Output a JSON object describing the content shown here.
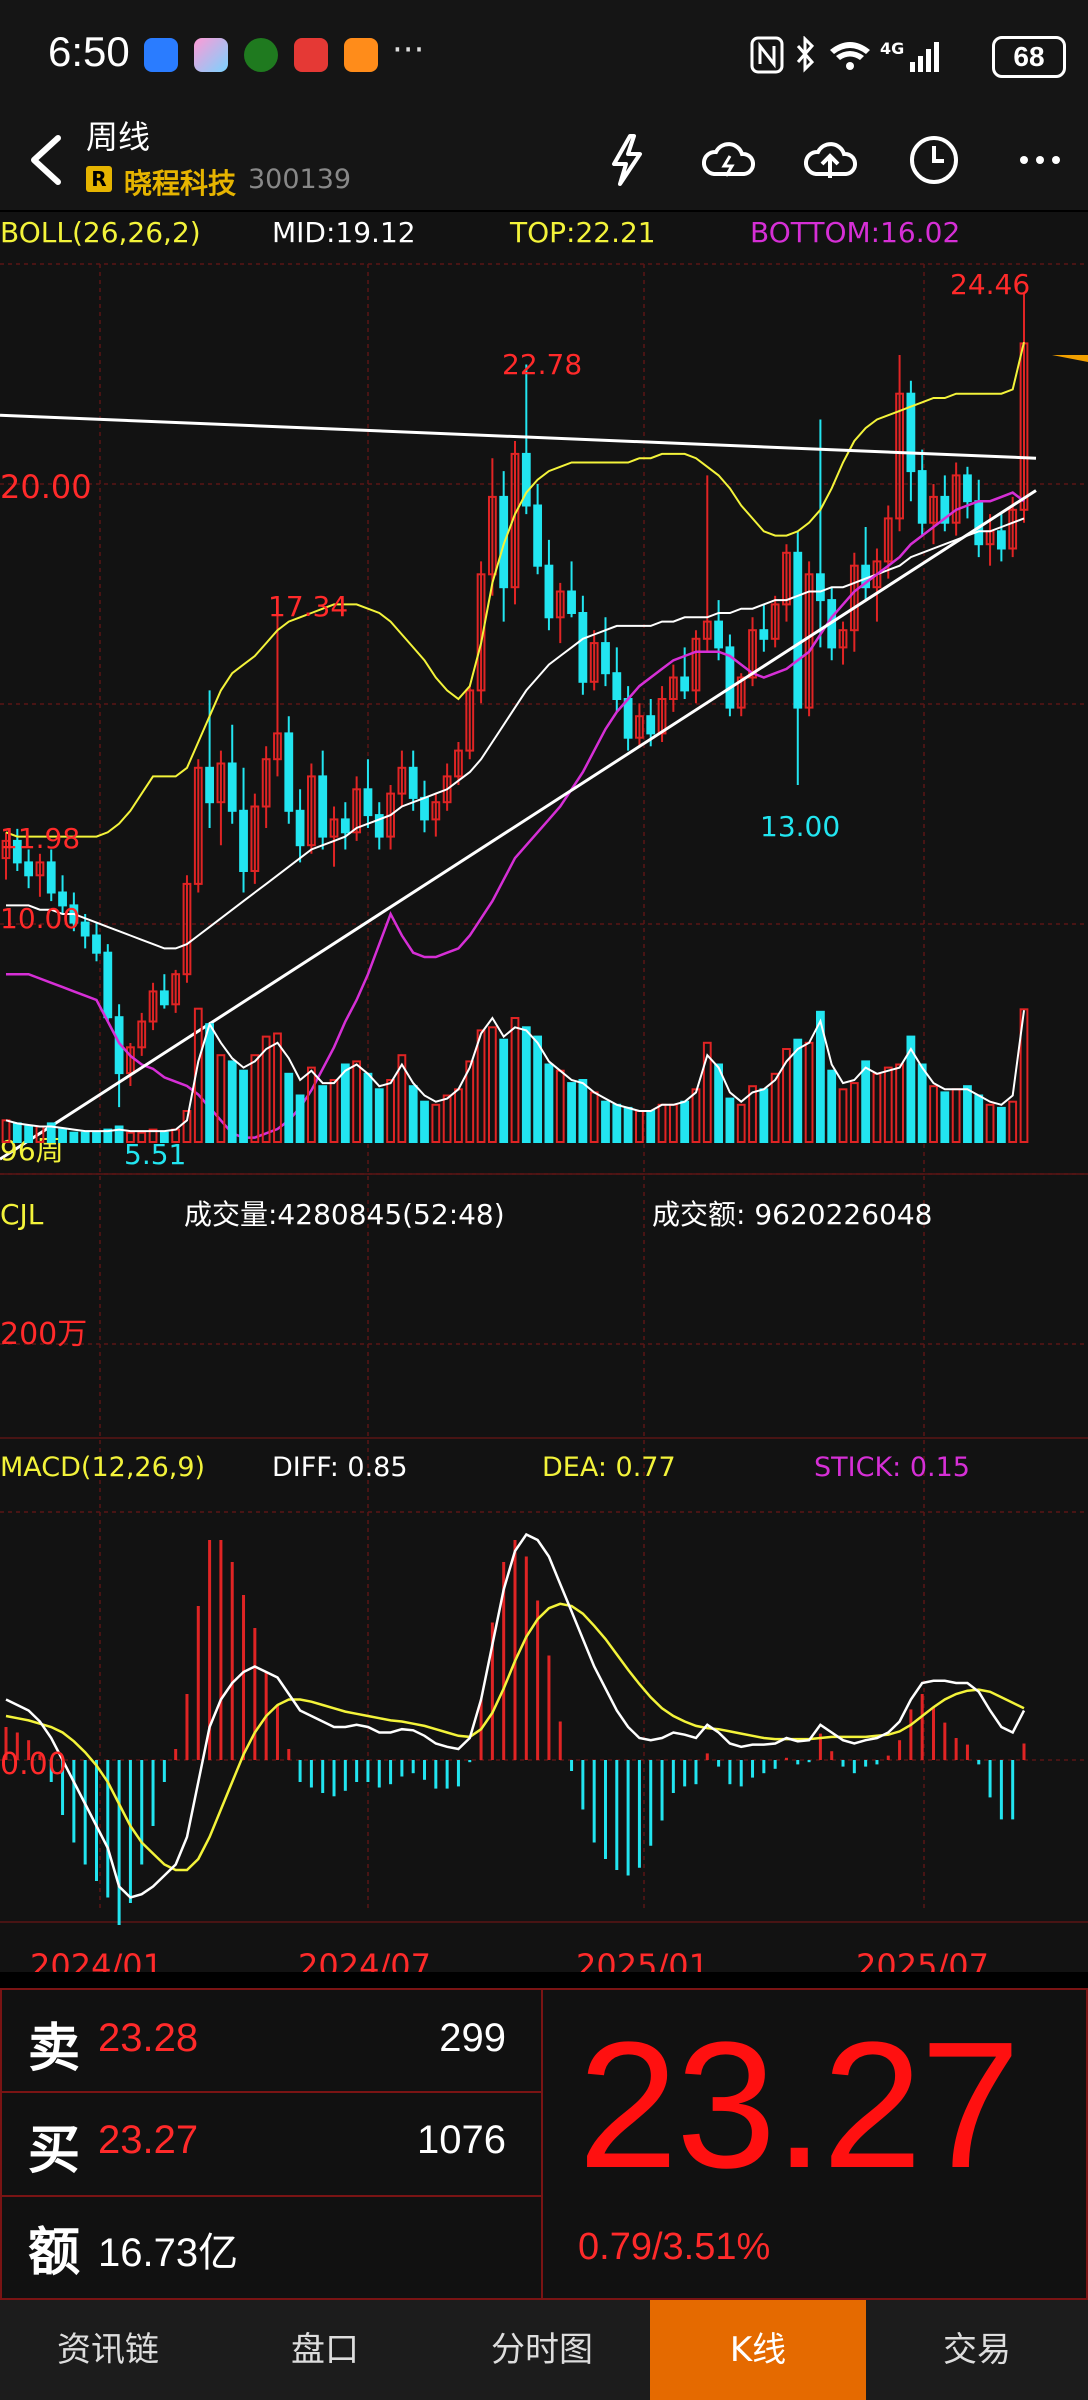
{
  "status_bar": {
    "time": "6:50",
    "more": "···",
    "network": "4G",
    "battery": "68",
    "icons": [
      "weather-icon",
      "gallery-icon",
      "game-icon",
      "huawei-icon",
      "video-icon",
      "nfc-icon",
      "bluetooth-icon",
      "wifi-icon",
      "signal-icon"
    ]
  },
  "header": {
    "title": "周线",
    "badge": "R",
    "stock_name": "晓程科技",
    "stock_code": "300139",
    "icons": [
      "back-icon",
      "flash-icon",
      "cloud-refresh-icon",
      "cloud-upload-icon",
      "clock-icon",
      "more-icon"
    ]
  },
  "boll": {
    "label": "BOLL(26,26,2)",
    "mid": "MID:19.12",
    "top": "TOP:22.21",
    "bottom": "BOTTOM:16.02"
  },
  "price_chart": {
    "y_label_20": "20.00",
    "y_label_10": "10.00",
    "y_label_1198": "11.98",
    "period_label": "96周",
    "annotations": {
      "high_2446": "24.46",
      "high_2278": "22.78",
      "high_1734": "17.34",
      "low_1300": "13.00",
      "low_551": "5.51"
    }
  },
  "volume": {
    "label": "CJL",
    "volume_text": "成交量:4280845(52:48)",
    "amount_text": "成交额: 9620226048",
    "y_label": "200万"
  },
  "macd": {
    "label": "MACD(12,26,9)",
    "diff": "DIFF: 0.85",
    "dea": "DEA: 0.77",
    "stick": "STICK: 0.15",
    "zero_label": "0.00"
  },
  "x_axis": [
    "2024/01",
    "2024/07",
    "2025/01",
    "2025/07"
  ],
  "quote": {
    "sell_label": "卖",
    "sell_price": "23.28",
    "sell_volume": "299",
    "buy_label": "买",
    "buy_price": "23.27",
    "buy_volume": "1076",
    "amount_label": "额",
    "amount_value": "16.73亿",
    "last_price": "23.27",
    "change": "0.79/3.51%"
  },
  "tabs": [
    {
      "label": "资讯链",
      "active": false
    },
    {
      "label": "盘口",
      "active": false
    },
    {
      "label": "分时图",
      "active": false
    },
    {
      "label": "K线",
      "active": true
    },
    {
      "label": "交易",
      "active": false
    }
  ],
  "colors": {
    "up": "#e02424",
    "down": "#22e5f0",
    "boll_top_bottom_upper": "#f3f33a",
    "boll_mid": "#ffffff",
    "boll_lower": "#d62fd6",
    "accent": "#e56a00",
    "grid": "#5a1010"
  },
  "chart_data": {
    "type": "candlestick",
    "candles": [
      [
        11.3,
        11.9,
        10.8,
        11.7
      ],
      [
        11.7,
        11.98,
        11.0,
        11.2
      ],
      [
        11.2,
        11.5,
        10.6,
        10.9
      ],
      [
        10.9,
        11.4,
        10.4,
        11.2
      ],
      [
        11.2,
        11.5,
        10.3,
        10.5
      ],
      [
        10.5,
        10.9,
        10.0,
        10.2
      ],
      [
        10.2,
        10.5,
        9.6,
        9.8
      ],
      [
        9.8,
        10.0,
        9.2,
        9.5
      ],
      [
        9.5,
        9.8,
        8.9,
        9.1
      ],
      [
        9.1,
        9.3,
        7.5,
        7.6
      ],
      [
        7.6,
        7.9,
        5.51,
        6.3
      ],
      [
        6.3,
        7.0,
        6.0,
        6.9
      ],
      [
        6.9,
        7.7,
        6.7,
        7.5
      ],
      [
        7.5,
        8.4,
        7.3,
        8.2
      ],
      [
        8.2,
        8.6,
        7.8,
        7.9
      ],
      [
        7.9,
        8.7,
        7.7,
        8.6
      ],
      [
        8.6,
        10.9,
        8.4,
        10.7
      ],
      [
        10.7,
        13.6,
        10.5,
        13.4
      ],
      [
        13.4,
        15.2,
        12.0,
        12.6
      ],
      [
        12.6,
        13.8,
        11.6,
        13.5
      ],
      [
        13.5,
        14.4,
        12.1,
        12.4
      ],
      [
        12.4,
        13.4,
        10.5,
        11.0
      ],
      [
        11.0,
        12.8,
        10.7,
        12.5
      ],
      [
        12.5,
        13.9,
        12.0,
        13.6
      ],
      [
        13.6,
        17.34,
        13.2,
        14.2
      ],
      [
        14.2,
        14.6,
        12.1,
        12.4
      ],
      [
        12.4,
        12.9,
        11.2,
        11.6
      ],
      [
        11.6,
        13.5,
        11.4,
        13.2
      ],
      [
        13.2,
        13.8,
        11.5,
        11.8
      ],
      [
        11.8,
        12.5,
        11.1,
        12.2
      ],
      [
        12.2,
        12.6,
        11.5,
        11.9
      ],
      [
        11.9,
        13.2,
        11.7,
        12.9
      ],
      [
        12.9,
        13.6,
        12.0,
        12.3
      ],
      [
        12.3,
        12.6,
        11.5,
        11.8
      ],
      [
        11.8,
        13.0,
        11.5,
        12.8
      ],
      [
        12.8,
        13.8,
        12.5,
        13.4
      ],
      [
        13.4,
        13.8,
        12.4,
        12.7
      ],
      [
        12.7,
        13.1,
        11.9,
        12.2
      ],
      [
        12.2,
        12.8,
        11.8,
        12.6
      ],
      [
        12.6,
        13.5,
        12.4,
        13.2
      ],
      [
        13.2,
        14.0,
        13.0,
        13.8
      ],
      [
        13.8,
        15.3,
        13.6,
        15.2
      ],
      [
        15.2,
        18.2,
        14.9,
        17.9
      ],
      [
        17.9,
        20.6,
        17.4,
        19.7
      ],
      [
        19.7,
        20.3,
        16.8,
        17.6
      ],
      [
        17.6,
        21.0,
        17.2,
        20.7
      ],
      [
        20.7,
        22.78,
        19.3,
        19.5
      ],
      [
        19.5,
        20.0,
        17.9,
        18.1
      ],
      [
        18.1,
        18.7,
        16.6,
        16.9
      ],
      [
        16.9,
        17.7,
        16.3,
        17.5
      ],
      [
        17.5,
        18.2,
        16.9,
        17.0
      ],
      [
        17.0,
        17.4,
        15.1,
        15.4
      ],
      [
        15.4,
        16.6,
        15.2,
        16.3
      ],
      [
        16.3,
        16.9,
        15.3,
        15.6
      ],
      [
        15.6,
        16.2,
        14.7,
        15.0
      ],
      [
        15.0,
        15.3,
        13.8,
        14.1
      ],
      [
        14.1,
        14.9,
        13.9,
        14.6
      ],
      [
        14.6,
        15.0,
        13.9,
        14.2
      ],
      [
        14.2,
        15.3,
        14.0,
        15.0
      ],
      [
        15.0,
        15.8,
        14.7,
        15.5
      ],
      [
        15.5,
        16.2,
        15.0,
        15.2
      ],
      [
        15.2,
        16.6,
        14.9,
        16.4
      ],
      [
        16.4,
        20.2,
        16.1,
        16.8
      ],
      [
        16.8,
        17.3,
        15.9,
        16.2
      ],
      [
        16.2,
        16.5,
        14.6,
        14.8
      ],
      [
        14.8,
        15.6,
        14.6,
        15.5
      ],
      [
        15.5,
        16.9,
        15.3,
        16.6
      ],
      [
        16.6,
        17.2,
        16.1,
        16.4
      ],
      [
        16.4,
        17.4,
        16.2,
        17.2
      ],
      [
        17.2,
        18.6,
        16.8,
        18.4
      ],
      [
        18.4,
        18.9,
        13.0,
        14.8
      ],
      [
        14.8,
        18.2,
        14.6,
        17.9
      ],
      [
        17.9,
        21.5,
        16.2,
        17.3
      ],
      [
        17.3,
        17.6,
        15.9,
        16.2
      ],
      [
        16.2,
        16.8,
        15.8,
        16.6
      ],
      [
        16.6,
        18.4,
        16.1,
        18.1
      ],
      [
        18.1,
        19.0,
        17.3,
        17.6
      ],
      [
        17.6,
        18.5,
        16.8,
        18.2
      ],
      [
        18.2,
        19.5,
        17.8,
        19.2
      ],
      [
        19.2,
        23.0,
        18.9,
        22.1
      ],
      [
        22.1,
        22.4,
        19.6,
        20.3
      ],
      [
        20.3,
        20.8,
        18.8,
        19.1
      ],
      [
        19.1,
        20.0,
        18.6,
        19.7
      ],
      [
        19.7,
        20.2,
        18.9,
        19.1
      ],
      [
        19.1,
        20.5,
        18.8,
        20.2
      ],
      [
        20.2,
        20.4,
        19.2,
        19.6
      ],
      [
        19.6,
        20.1,
        18.3,
        18.6
      ],
      [
        18.6,
        19.3,
        18.1,
        18.9
      ],
      [
        18.9,
        19.3,
        18.2,
        18.5
      ],
      [
        18.5,
        19.7,
        18.3,
        19.4
      ],
      [
        19.4,
        24.46,
        19.1,
        23.27
      ]
    ],
    "boll_upper": [
      11.9,
      11.8,
      11.8,
      11.8,
      11.8,
      11.8,
      11.8,
      11.8,
      11.8,
      11.9,
      12.1,
      12.4,
      12.8,
      13.2,
      13.2,
      13.2,
      13.4,
      14.0,
      14.6,
      15.2,
      15.6,
      15.8,
      16.0,
      16.3,
      16.6,
      16.8,
      16.9,
      17.0,
      17.1,
      17.2,
      17.2,
      17.2,
      17.1,
      17.0,
      16.8,
      16.5,
      16.2,
      15.9,
      15.5,
      15.2,
      15.0,
      15.3,
      16.3,
      17.7,
      18.6,
      19.3,
      19.8,
      20.1,
      20.3,
      20.4,
      20.5,
      20.5,
      20.5,
      20.5,
      20.5,
      20.5,
      20.6,
      20.6,
      20.7,
      20.7,
      20.7,
      20.6,
      20.4,
      20.2,
      19.9,
      19.5,
      19.2,
      18.9,
      18.8,
      18.8,
      18.9,
      19.1,
      19.4,
      19.9,
      20.5,
      21.0,
      21.3,
      21.5,
      21.6,
      21.7,
      21.8,
      21.9,
      22.0,
      22.0,
      22.1,
      22.1,
      22.1,
      22.1,
      22.1,
      22.2,
      23.3
    ],
    "boll_mid": [
      10.2,
      10.2,
      10.2,
      10.1,
      10.1,
      10.0,
      10.0,
      9.9,
      9.8,
      9.7,
      9.6,
      9.5,
      9.4,
      9.3,
      9.2,
      9.2,
      9.3,
      9.5,
      9.7,
      9.9,
      10.1,
      10.3,
      10.5,
      10.7,
      10.9,
      11.1,
      11.3,
      11.5,
      11.6,
      11.7,
      11.8,
      12.0,
      12.1,
      12.2,
      12.3,
      12.5,
      12.6,
      12.7,
      12.8,
      12.9,
      13.1,
      13.3,
      13.6,
      14.0,
      14.4,
      14.8,
      15.2,
      15.5,
      15.8,
      16.0,
      16.2,
      16.4,
      16.5,
      16.6,
      16.7,
      16.7,
      16.7,
      16.7,
      16.8,
      16.8,
      16.9,
      16.9,
      16.9,
      17.0,
      17.0,
      17.1,
      17.1,
      17.2,
      17.3,
      17.3,
      17.4,
      17.5,
      17.5,
      17.6,
      17.6,
      17.7,
      17.8,
      17.9,
      18.0,
      18.1,
      18.3,
      18.4,
      18.5,
      18.6,
      18.7,
      18.8,
      18.9,
      18.9,
      19.0,
      19.1,
      19.2
    ],
    "boll_lower": [
      8.6,
      8.6,
      8.6,
      8.5,
      8.4,
      8.3,
      8.2,
      8.1,
      8.0,
      7.5,
      7.0,
      6.7,
      6.5,
      6.4,
      6.2,
      6.1,
      6.0,
      5.8,
      5.5,
      5.2,
      4.9,
      4.8,
      4.8,
      4.9,
      5.0,
      5.2,
      5.5,
      5.9,
      6.4,
      6.9,
      7.5,
      8.0,
      8.6,
      9.3,
      10.0,
      9.5,
      9.1,
      9.0,
      9.0,
      9.1,
      9.2,
      9.5,
      9.9,
      10.3,
      10.8,
      11.3,
      11.6,
      11.9,
      12.2,
      12.5,
      12.9,
      13.3,
      13.8,
      14.3,
      14.7,
      15.0,
      15.3,
      15.5,
      15.7,
      15.9,
      16.0,
      16.1,
      16.1,
      16.1,
      16.0,
      15.8,
      15.6,
      15.5,
      15.6,
      15.7,
      15.9,
      16.1,
      16.5,
      16.9,
      17.2,
      17.5,
      17.7,
      17.9,
      18.1,
      18.3,
      18.6,
      18.8,
      19.0,
      19.2,
      19.4,
      19.5,
      19.6,
      19.6,
      19.7,
      19.8,
      19.6
    ],
    "trend_lines": [
      {
        "from": [
          0,
          21.6
        ],
        "to": [
          90,
          20.6
        ]
      },
      {
        "from": [
          0,
          4.3
        ],
        "to": [
          90,
          19.85
        ]
      }
    ],
    "volume": [
      0.7,
      0.6,
      0.5,
      0.5,
      0.6,
      0.4,
      0.3,
      0.3,
      0.3,
      0.4,
      0.5,
      0.3,
      0.3,
      0.4,
      0.3,
      0.4,
      1.0,
      4.3,
      3.8,
      2.8,
      2.6,
      2.3,
      2.8,
      3.4,
      3.5,
      2.2,
      1.5,
      2.4,
      1.8,
      2.0,
      2.5,
      2.6,
      2.2,
      1.7,
      2.0,
      2.8,
      1.8,
      1.3,
      1.2,
      1.5,
      1.7,
      2.6,
      3.6,
      3.7,
      3.3,
      4.0,
      3.7,
      3.4,
      2.5,
      2.3,
      1.9,
      2.0,
      1.6,
      1.3,
      1.2,
      1.1,
      1.0,
      1.0,
      1.2,
      1.2,
      1.3,
      1.7,
      3.2,
      2.5,
      1.4,
      1.2,
      1.8,
      1.7,
      2.2,
      3.0,
      3.3,
      3.2,
      4.2,
      2.3,
      1.7,
      1.9,
      2.6,
      2.2,
      2.4,
      2.5,
      3.4,
      2.5,
      1.8,
      1.6,
      1.7,
      1.8,
      1.5,
      1.2,
      1.1,
      1.3,
      4.28
    ],
    "volume_ma": [
      0.7,
      0.6,
      0.55,
      0.5,
      0.5,
      0.45,
      0.4,
      0.35,
      0.35,
      0.35,
      0.4,
      0.35,
      0.35,
      0.35,
      0.35,
      0.4,
      0.7,
      2.6,
      3.8,
      3.2,
      2.7,
      2.4,
      2.6,
      3.0,
      3.2,
      2.7,
      2.0,
      2.3,
      1.9,
      1.9,
      2.3,
      2.5,
      2.2,
      1.8,
      1.9,
      2.5,
      1.9,
      1.5,
      1.3,
      1.4,
      1.7,
      2.4,
      3.5,
      4.0,
      3.4,
      3.7,
      3.6,
      3.2,
      2.6,
      2.3,
      2.0,
      1.9,
      1.6,
      1.4,
      1.2,
      1.1,
      1.0,
      1.0,
      1.2,
      1.2,
      1.3,
      1.6,
      2.8,
      2.4,
      1.6,
      1.3,
      1.6,
      1.7,
      2.0,
      2.6,
      3.0,
      3.2,
      3.9,
      2.5,
      1.9,
      2.0,
      2.4,
      2.2,
      2.3,
      2.4,
      3.0,
      2.4,
      1.9,
      1.7,
      1.7,
      1.7,
      1.5,
      1.3,
      1.2,
      1.5,
      4.25
    ],
    "macd_diff": [
      0.55,
      0.5,
      0.45,
      0.35,
      0.2,
      0.0,
      -0.2,
      -0.4,
      -0.6,
      -0.8,
      -1.15,
      -1.25,
      -1.22,
      -1.15,
      -1.05,
      -0.95,
      -0.7,
      -0.2,
      0.3,
      0.55,
      0.7,
      0.8,
      0.85,
      0.8,
      0.75,
      0.6,
      0.45,
      0.4,
      0.35,
      0.3,
      0.3,
      0.32,
      0.3,
      0.25,
      0.25,
      0.28,
      0.27,
      0.22,
      0.15,
      0.12,
      0.1,
      0.2,
      0.55,
      1.05,
      1.55,
      1.9,
      2.05,
      2.0,
      1.85,
      1.6,
      1.35,
      1.1,
      0.85,
      0.65,
      0.45,
      0.3,
      0.2,
      0.18,
      0.2,
      0.25,
      0.23,
      0.2,
      0.32,
      0.25,
      0.15,
      0.12,
      0.14,
      0.14,
      0.15,
      0.2,
      0.17,
      0.18,
      0.32,
      0.25,
      0.18,
      0.15,
      0.18,
      0.2,
      0.25,
      0.35,
      0.55,
      0.7,
      0.72,
      0.72,
      0.7,
      0.7,
      0.62,
      0.45,
      0.3,
      0.25,
      0.45
    ],
    "macd_dea": [
      0.4,
      0.38,
      0.36,
      0.33,
      0.3,
      0.25,
      0.17,
      0.07,
      -0.05,
      -0.2,
      -0.4,
      -0.6,
      -0.75,
      -0.85,
      -0.95,
      -1.0,
      -1.0,
      -0.9,
      -0.7,
      -0.45,
      -0.2,
      0.05,
      0.25,
      0.4,
      0.5,
      0.55,
      0.55,
      0.53,
      0.5,
      0.47,
      0.44,
      0.42,
      0.4,
      0.38,
      0.36,
      0.35,
      0.33,
      0.31,
      0.28,
      0.25,
      0.22,
      0.21,
      0.28,
      0.43,
      0.65,
      0.9,
      1.12,
      1.28,
      1.38,
      1.42,
      1.4,
      1.33,
      1.22,
      1.1,
      0.96,
      0.82,
      0.69,
      0.57,
      0.47,
      0.4,
      0.35,
      0.31,
      0.29,
      0.28,
      0.26,
      0.24,
      0.22,
      0.2,
      0.19,
      0.19,
      0.19,
      0.19,
      0.2,
      0.21,
      0.21,
      0.21,
      0.21,
      0.22,
      0.23,
      0.26,
      0.32,
      0.4,
      0.48,
      0.55,
      0.6,
      0.63,
      0.64,
      0.62,
      0.57,
      0.52,
      0.47
    ],
    "macd_hist": [
      0.3,
      0.25,
      0.18,
      0.05,
      -0.2,
      -0.5,
      -0.75,
      -0.95,
      -1.1,
      -1.25,
      -1.5,
      -1.3,
      -0.95,
      -0.6,
      -0.2,
      0.1,
      0.6,
      1.4,
      2.0,
      2.0,
      1.8,
      1.5,
      1.2,
      0.8,
      0.5,
      0.1,
      -0.2,
      -0.25,
      -0.3,
      -0.33,
      -0.28,
      -0.2,
      -0.2,
      -0.25,
      -0.22,
      -0.15,
      -0.12,
      -0.18,
      -0.26,
      -0.26,
      -0.24,
      -0.02,
      0.55,
      1.25,
      1.8,
      2.0,
      1.85,
      1.45,
      0.95,
      0.35,
      -0.1,
      -0.45,
      -0.75,
      -0.9,
      -1.0,
      -1.05,
      -0.98,
      -0.78,
      -0.55,
      -0.3,
      -0.24,
      -0.22,
      0.06,
      -0.06,
      -0.22,
      -0.24,
      -0.16,
      -0.12,
      -0.08,
      0.02,
      -0.04,
      -0.02,
      0.24,
      0.08,
      -0.06,
      -0.12,
      -0.06,
      -0.04,
      0.04,
      0.18,
      0.46,
      0.6,
      0.48,
      0.34,
      0.2,
      0.14,
      -0.04,
      -0.34,
      -0.54,
      -0.54,
      0.15
    ]
  }
}
